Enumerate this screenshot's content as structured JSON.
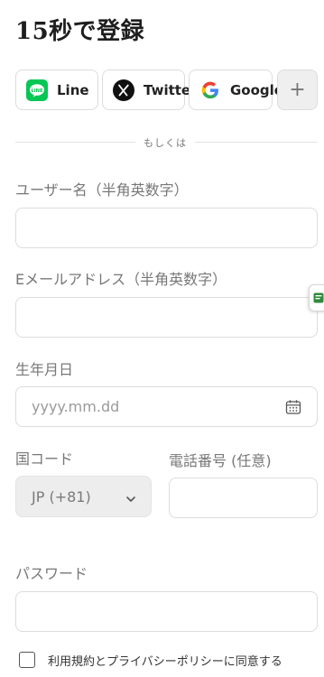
{
  "title": "15秒で登録",
  "sso": {
    "line_label": "Line",
    "twitter_label": "Twitter",
    "google_label": "Google",
    "more_label": "+"
  },
  "divider_text": "もしくは",
  "fields": {
    "username_label": "ユーザー名（半角英数字）",
    "email_label": "Eメールアドレス（半角英数字）",
    "birthdate_label": "生年月日",
    "birthdate_placeholder": "yyyy.mm.dd",
    "country_code_label": "国コード",
    "country_code_value": "JP (+81)",
    "phone_label": "電話番号 (任意)",
    "password_label": "パスワード"
  },
  "agree_label": "利用規約とプライバシーポリシーに同意する",
  "colors": {
    "line_green": "#06C755",
    "border": "#dcdcdc",
    "label_gray": "#777777"
  }
}
